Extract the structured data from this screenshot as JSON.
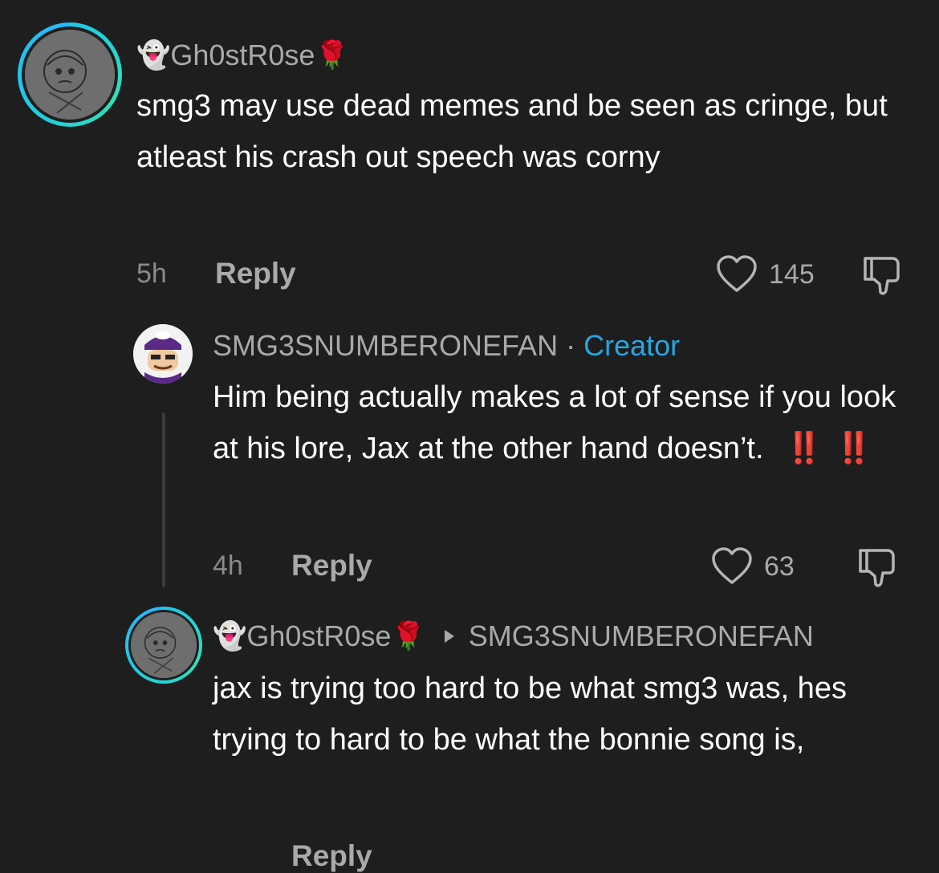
{
  "comment1": {
    "author": "Gh0stR0se",
    "author_emoji_prefix": "👻",
    "author_emoji_suffix": "🌹",
    "text": "smg3 may use dead memes and be seen as cringe, but atleast his crash out speech was corny",
    "time": "5h",
    "reply_label": "Reply",
    "likes": "145"
  },
  "reply1": {
    "author": "SMG3SNUMBERONEFAN",
    "separator": "·",
    "badge": "Creator",
    "text": "Him being actually makes a lot of sense if you look at his lore, Jax at the other hand doesn’t.",
    "emphasis": "‼️ ‼️",
    "time": "4h",
    "reply_label": "Reply",
    "likes": "63"
  },
  "reply2": {
    "author": "Gh0stR0se",
    "author_emoji_prefix": "👻",
    "author_emoji_suffix": "🌹",
    "reply_to": "SMG3SNUMBERONEFAN",
    "text": "jax is trying too hard to be what smg3 was, hes trying to hard to be what the bonnie song is,",
    "reply_label": "Reply"
  },
  "colors": {
    "background": "#1e1e1e",
    "creator_badge": "#26a6e0",
    "emphasis": "#e3261d",
    "avatar_ring": "#1ec9e8"
  }
}
